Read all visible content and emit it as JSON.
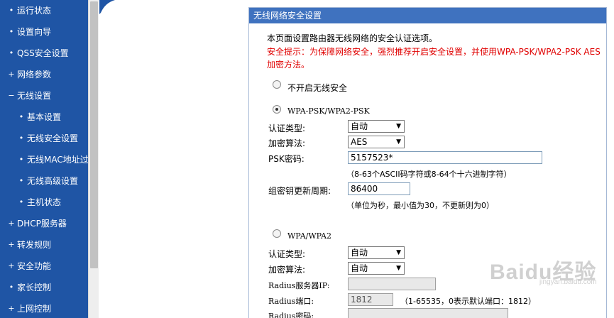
{
  "sidebar": {
    "items": [
      {
        "bullet": "•",
        "label": "运行状态"
      },
      {
        "bullet": "•",
        "label": "设置向导"
      },
      {
        "bullet": "•",
        "label": "QSS安全设置"
      },
      {
        "bullet": "+",
        "label": "网络参数"
      },
      {
        "bullet": "−",
        "label": "无线设置"
      },
      {
        "bullet": "•",
        "label": "基本设置"
      },
      {
        "bullet": "•",
        "label": "无线安全设置"
      },
      {
        "bullet": "•",
        "label": "无线MAC地址过滤"
      },
      {
        "bullet": "•",
        "label": "无线高级设置"
      },
      {
        "bullet": "•",
        "label": "主机状态"
      },
      {
        "bullet": "+",
        "label": "DHCP服务器"
      },
      {
        "bullet": "+",
        "label": "转发规则"
      },
      {
        "bullet": "+",
        "label": "安全功能"
      },
      {
        "bullet": "•",
        "label": "家长控制"
      },
      {
        "bullet": "+",
        "label": "上网控制"
      }
    ]
  },
  "panel": {
    "title": "无线网络安全设置",
    "intro": "本页面设置路由器无线网络的安全认证选项。",
    "warning_line1": "安全提示：为保障网络安全，强烈推荐开启安全设置，并使用WPA-PSK/WPA2-PSK AES",
    "warning_line2": "加密方法。",
    "option_none": "不开启无线安全",
    "option_psk": "WPA-PSK/WPA2-PSK",
    "psk": {
      "auth_label": "认证类型:",
      "auth_value": "自动",
      "enc_label": "加密算法:",
      "enc_value": "AES",
      "key_label": "PSK密码:",
      "key_value": "5157523*",
      "key_hint": "（8-63个ASCII码字符或8-64个十六进制字符）",
      "period_label": "组密钥更新周期:",
      "period_value": "86400",
      "period_hint": "（单位为秒，最小值为30，不更新则为0）"
    },
    "option_wpa": "WPA/WPA2",
    "wpa": {
      "auth_label": "认证类型:",
      "auth_value": "自动",
      "enc_label": "加密算法:",
      "enc_value": "自动",
      "server_ip_label": "Radius服务器IP:",
      "server_ip_value": "",
      "port_label": "Radius端口:",
      "port_value": "1812",
      "port_hint": "（1-65535，0表示默认端口：1812）",
      "password_label": "Radius密码:",
      "password_value": ""
    }
  },
  "watermark": {
    "main": "Baidu经验",
    "sub": "jingyan.baidu.com"
  },
  "colors": {
    "sidebar": "#1f55a5",
    "header": "#3f72bf",
    "warning": "#e00000"
  }
}
